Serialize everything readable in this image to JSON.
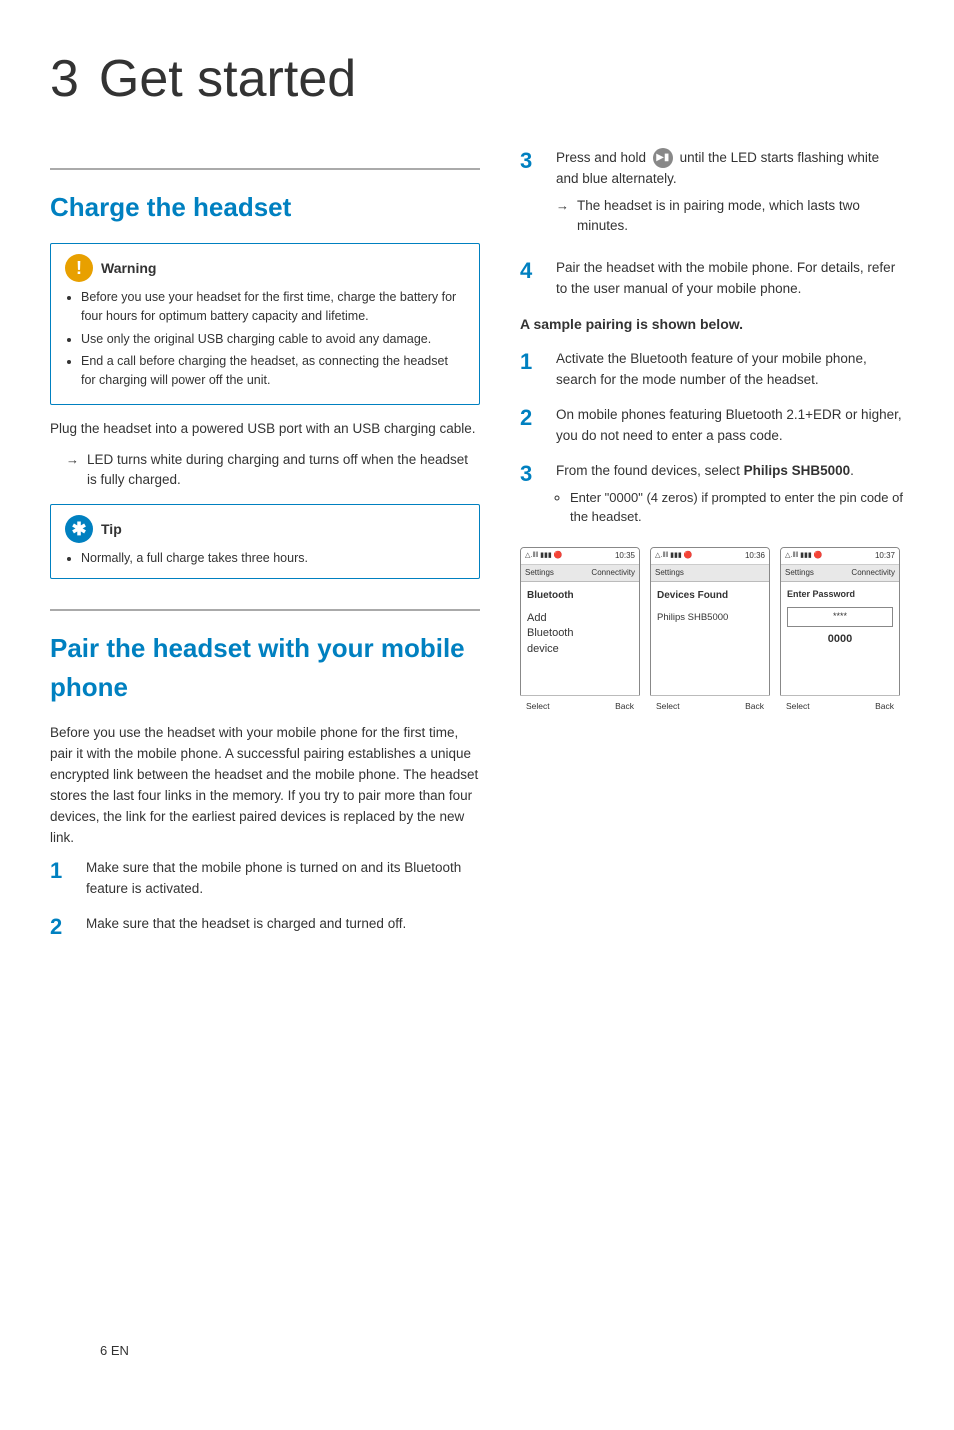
{
  "chapter": {
    "number": "3",
    "title": "Get started"
  },
  "charge_section": {
    "title": "Charge the headset",
    "warning": {
      "label": "Warning",
      "bullets": [
        "Before you use your headset for the first time, charge the battery for four hours for optimum battery capacity and lifetime.",
        "Use only the original USB charging cable to avoid any damage.",
        "End a call before charging the headset, as connecting the headset for charging will power off the unit."
      ]
    },
    "body1": "Plug the headset into a powered USB port with an USB charging cable.",
    "arrow1": "LED turns white during charging and turns off when the headset is fully charged.",
    "tip": {
      "label": "Tip",
      "bullets": [
        "Normally, a full charge takes three hours."
      ]
    }
  },
  "pair_section": {
    "title": "Pair the headset with your mobile phone",
    "body1": "Before you use the headset with your mobile phone for the first time, pair it with the mobile phone. A successful pairing establishes a unique encrypted link between the headset and the mobile phone. The headset stores the last four links in the memory. If you try to pair more than four devices, the link for the earliest paired devices is replaced by the new link.",
    "steps": [
      "Make sure that the mobile phone is turned on and its Bluetooth feature is activated.",
      "Make sure that the headset is charged and turned off."
    ]
  },
  "right_col": {
    "step3_text": "Press and hold",
    "step3_icon": "call-button-icon",
    "step3_rest": "until the LED starts flashing white and blue alternately.",
    "step3_arrow": "The headset is in pairing mode, which lasts two minutes.",
    "step4_text": "Pair the headset with the mobile phone. For details, refer to the user manual of your mobile phone.",
    "sample_heading": "A sample pairing is shown below.",
    "sample_steps": [
      "Activate the Bluetooth feature of your mobile phone, search for the mode number of the headset.",
      "On mobile phones featuring Bluetooth 2.1+EDR or higher, you do not need to enter a pass code.",
      "From the found devices, select Philips SHB5000."
    ],
    "step3_sub_bullet": "Enter \"0000\" (4 zeros) if prompted to enter the pin code of the headset.",
    "screens": [
      {
        "time": "10:35",
        "nav_left": "Settings",
        "nav_right": "Connectivity",
        "section": "Bluetooth",
        "content": "Add\nBluetooth\ndevice",
        "bottom_left": "Select",
        "bottom_right": "Back"
      },
      {
        "time": "10:36",
        "nav_left": "Settings",
        "nav_right": "",
        "section": "Devices Found",
        "content": "Philips SHB5000",
        "bottom_left": "Select",
        "bottom_right": "Back"
      },
      {
        "time": "10:37",
        "nav_left": "Settings",
        "nav_right": "Connectivity",
        "section": "",
        "content": "Enter Password",
        "pw_field": "****",
        "pw_code": "0000",
        "bottom_left": "Select",
        "bottom_right": "Back"
      }
    ]
  },
  "footer": {
    "page_number": "6",
    "language": "EN"
  }
}
